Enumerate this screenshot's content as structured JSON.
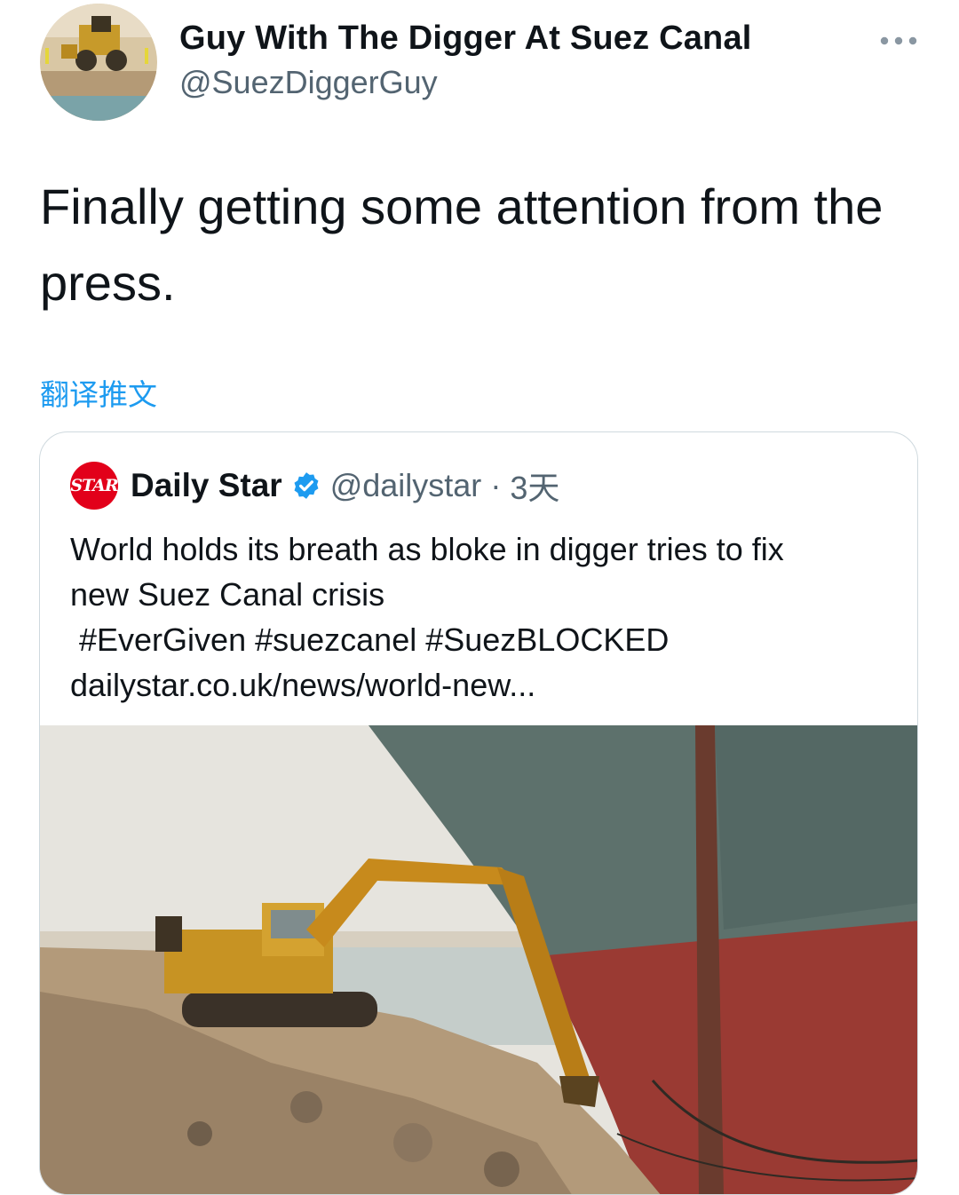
{
  "tweet": {
    "author_name": "Guy With The Digger At Suez Canal",
    "author_handle": "@SuezDiggerGuy",
    "text": "Finally getting some attention from the press.",
    "translate_label": "翻译推文",
    "more_icon": "more-horizontal-icon"
  },
  "quote": {
    "logo_text": "STAR",
    "author_name": "Daily Star",
    "author_handle": "@dailystar",
    "separator": "·",
    "time": "3天",
    "verified_icon": "verified-badge-icon",
    "text_line1": "World holds its breath as bloke in digger tries to fix",
    "text_line2": "new Suez Canal crisis",
    "hashtags": " #EverGiven #suezcanel #SuezBLOCKED",
    "url": "dailystar.co.uk/news/world-new..."
  },
  "colors": {
    "link_blue": "#1d9bf0",
    "secondary_text": "#536471",
    "brand_red": "#e2001a"
  }
}
